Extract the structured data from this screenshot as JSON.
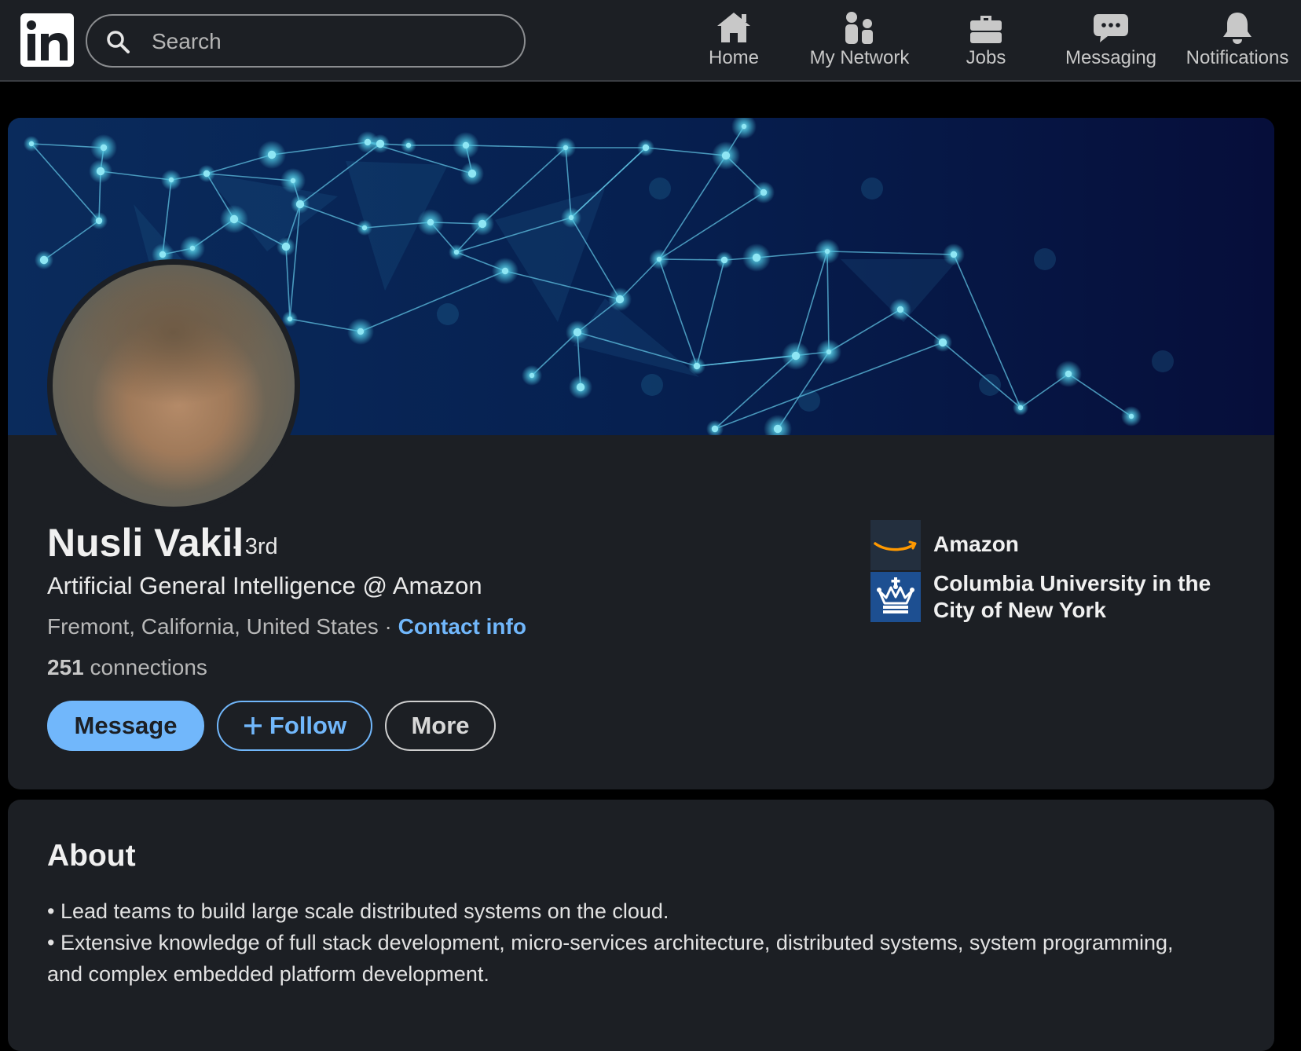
{
  "nav": {
    "search_placeholder": "Search",
    "items": [
      {
        "label": "Home",
        "icon": "home-icon"
      },
      {
        "label": "My Network",
        "icon": "people-icon"
      },
      {
        "label": "Jobs",
        "icon": "briefcase-icon"
      },
      {
        "label": "Messaging",
        "icon": "speech-bubble-icon"
      },
      {
        "label": "Notifications",
        "icon": "bell-icon"
      }
    ]
  },
  "profile": {
    "name": "Nusli Vakil",
    "degree": "· 3rd",
    "headline": "Artificial General Intelligence @ Amazon",
    "location": "Fremont, California, United States ·",
    "contact_label": "Contact info",
    "connections_count": "251",
    "connections_label": "connections",
    "buttons": {
      "message": "Message",
      "follow": "Follow",
      "more": "More"
    },
    "orgs": [
      {
        "name": "Amazon",
        "icon": "amazon-logo-icon"
      },
      {
        "name": "Columbia University in the City of New York",
        "icon": "columbia-crown-icon"
      }
    ]
  },
  "about": {
    "title": "About",
    "lines": [
      "• Lead teams to build large scale distributed systems on the cloud.",
      "• Extensive knowledge of full stack development, micro-services architecture, distributed systems, system programming, and complex embedded platform development."
    ]
  },
  "colors": {
    "accent": "#71b7fb",
    "card_bg": "#1c1f24",
    "page_bg": "#000000",
    "banner_bg": "#051640"
  }
}
